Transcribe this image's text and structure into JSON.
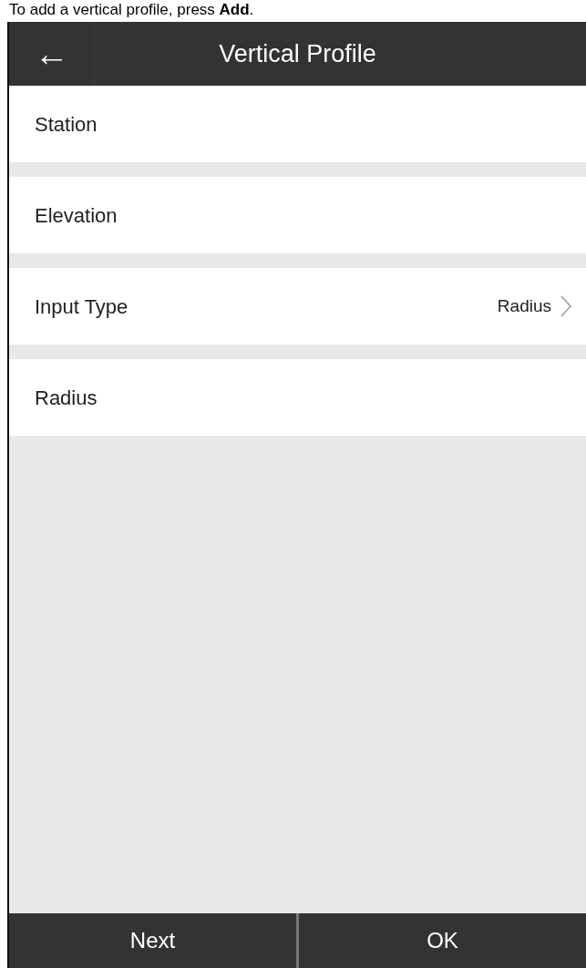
{
  "caption": "To add a vertical profile, press **Add**.",
  "header": {
    "back_icon": "←",
    "title": "Vertical Profile"
  },
  "fields": [
    {
      "label": "Station",
      "kind": "text"
    },
    {
      "label": "Elevation",
      "kind": "text"
    },
    {
      "label": "Input Type",
      "kind": "select",
      "value": "Radius"
    },
    {
      "label": "Radius",
      "kind": "text"
    }
  ],
  "buttons": [
    "Next",
    "OK"
  ]
}
